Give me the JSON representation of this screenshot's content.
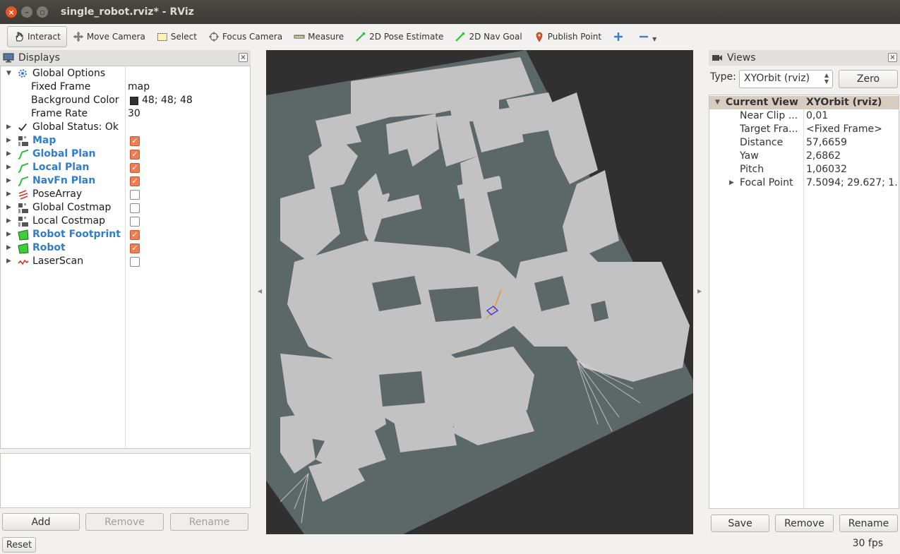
{
  "window": {
    "title": "single_robot.rviz* - RViz"
  },
  "toolbar": {
    "tools": [
      {
        "label": "Interact",
        "icon": "hand-pointer-icon"
      },
      {
        "label": "Move Camera",
        "icon": "move-camera-icon"
      },
      {
        "label": "Select",
        "icon": "select-icon"
      },
      {
        "label": "Focus Camera",
        "icon": "focus-camera-icon"
      },
      {
        "label": "Measure",
        "icon": "measure-icon"
      },
      {
        "label": "2D Pose Estimate",
        "icon": "pose-estimate-arrow-icon"
      },
      {
        "label": "2D Nav Goal",
        "icon": "nav-goal-arrow-icon"
      },
      {
        "label": "Publish Point",
        "icon": "map-pin-icon"
      }
    ]
  },
  "displays": {
    "title": "Displays",
    "global_options": {
      "label": "Global Options",
      "fixed_frame_label": "Fixed Frame",
      "fixed_frame": "map",
      "background_color_label": "Background Color",
      "background_color": "48; 48; 48",
      "frame_rate_label": "Frame Rate",
      "frame_rate": "30"
    },
    "global_status": "Global Status: Ok",
    "items": [
      {
        "label": "Map",
        "enabled": true
      },
      {
        "label": "Global Plan",
        "enabled": true
      },
      {
        "label": "Local Plan",
        "enabled": true
      },
      {
        "label": "NavFn Plan",
        "enabled": true
      },
      {
        "label": "PoseArray",
        "enabled": false
      },
      {
        "label": "Global Costmap",
        "enabled": false
      },
      {
        "label": "Local Costmap",
        "enabled": false
      },
      {
        "label": "Robot Footprint",
        "enabled": true
      },
      {
        "label": "Robot",
        "enabled": true
      },
      {
        "label": "LaserScan",
        "enabled": false
      }
    ],
    "buttons": {
      "add": "Add",
      "remove": "Remove",
      "rename": "Rename"
    }
  },
  "views": {
    "title": "Views",
    "type_label": "Type:",
    "type_value": "XYOrbit (rviz)",
    "zero_button": "Zero",
    "current_view": {
      "label": "Current View",
      "value": "XYOrbit (rviz)"
    },
    "properties": [
      {
        "key": "Near Clip ...",
        "value": "0,01"
      },
      {
        "key": "Target Fra...",
        "value": "<Fixed Frame>"
      },
      {
        "key": "Distance",
        "value": "57,6659"
      },
      {
        "key": "Yaw",
        "value": "2,6862"
      },
      {
        "key": "Pitch",
        "value": "1,06032"
      },
      {
        "key": "Focal Point",
        "value": "7.5094; 29.627; 1..."
      }
    ],
    "buttons": {
      "save": "Save",
      "remove": "Remove",
      "rename": "Rename"
    }
  },
  "statusbar": {
    "reset": "Reset",
    "fps": "30 fps"
  },
  "colors": {
    "accent": "#e95420",
    "checked": "#ef7d53",
    "enabled_label": "#2f7dd0",
    "map_free": "#c0c0c0",
    "map_unknown": "#5b6867",
    "viewport_bg": "#303030"
  }
}
